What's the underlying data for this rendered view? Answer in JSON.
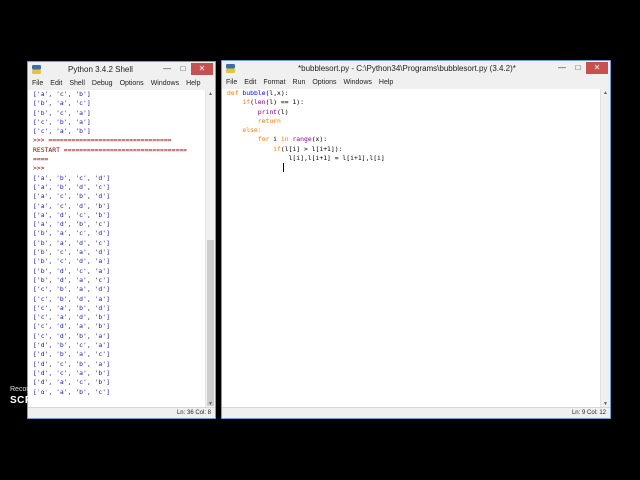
{
  "shell": {
    "title": "Python 3.4.2 Shell",
    "menu": [
      "File",
      "Edit",
      "Shell",
      "Debug",
      "Options",
      "Windows",
      "Help"
    ],
    "lines": [
      "['a', 'c', 'b']",
      "['b', 'a', 'c']",
      "['b', 'c', 'a']",
      "['c', 'b', 'a']",
      "['c', 'a', 'b']",
      ">>> ================================",
      "RESTART ================================",
      "====",
      ">>>",
      "['a', 'b', 'c', 'd']",
      "['a', 'b', 'd', 'c']",
      "['a', 'c', 'b', 'd']",
      "['a', 'c', 'd', 'b']",
      "['a', 'd', 'c', 'b']",
      "['a', 'd', 'b', 'c']",
      "['b', 'a', 'c', 'd']",
      "['b', 'a', 'd', 'c']",
      "['b', 'c', 'a', 'd']",
      "['b', 'c', 'd', 'a']",
      "['b', 'd', 'c', 'a']",
      "['b', 'd', 'a', 'c']",
      "['c', 'b', 'a', 'd']",
      "['c', 'b', 'd', 'a']",
      "['c', 'a', 'b', 'd']",
      "['c', 'a', 'd', 'b']",
      "['c', 'd', 'a', 'b']",
      "['c', 'd', 'b', 'a']",
      "['d', 'b', 'c', 'a']",
      "['d', 'b', 'a', 'c']",
      "['d', 'c', 'b', 'a']",
      "['d', 'c', 'a', 'b']",
      "['d', 'a', 'c', 'b']",
      "['d', 'a', 'b', 'c']"
    ],
    "status": "Ln: 36 Col: 8"
  },
  "editor": {
    "title": "*bubblesort.py - C:\\Python34\\Programs\\bubblesort.py (3.4.2)*",
    "menu": [
      "File",
      "Edit",
      "Format",
      "Run",
      "Options",
      "Windows",
      "Help"
    ],
    "code": {
      "l1_kw": "def",
      "l1_name": "bubble",
      "l1_rest": "(l,x):",
      "l2_kw": "if",
      "l2_open": "(",
      "l2_bi": "len",
      "l2_rest": "(l) == 1):",
      "l3_bi": "print",
      "l3_rest": "(l)",
      "l4_kw": "return",
      "l5_kw": "else:",
      "l6_kw1": "for",
      "l6_mid1": " i ",
      "l6_kw2": "in",
      "l6_mid2": " ",
      "l6_bi": "range",
      "l6_rest": "(x):",
      "l7_kw": "if",
      "l7_rest": "(l[i] > l[i+1]):",
      "l8": "l[i],l[i+1] = l[i+1],l[i]"
    },
    "status": "Ln: 9 Col: 12"
  },
  "watermark": {
    "recorded": "Recorded with",
    "brand": "SCREENCAST-O-MATIC"
  }
}
